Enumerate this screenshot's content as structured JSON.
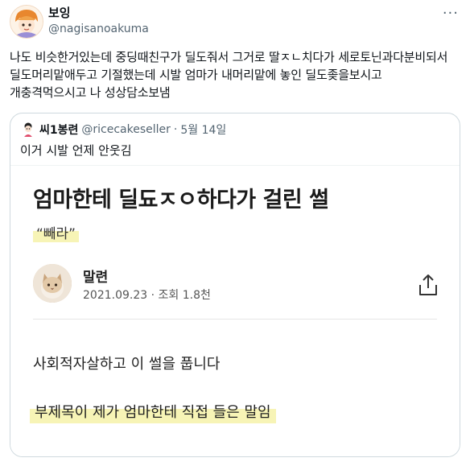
{
  "tweet": {
    "display_name": "보잉",
    "handle": "@nagisanoakuma",
    "text": "나도 비슷한거있는데 중딩때친구가 딜도줘서 그거로 딸ㅈㄴ치다가 세로토닌과다분비되서 딜도머리맡애두고 기절했는데 시발 엄마가 내머리맡에 놓인 딜도좆을보시고 개충격먹으시고 나 성상담소보냄",
    "more_icon": "more-icon"
  },
  "quote": {
    "display_name": "씨1봉련",
    "handle": "@ricecakeseller",
    "date": "5월 14일",
    "text": "이거 시발 언제 안웃김",
    "image": {
      "title": "엄마한테 딜됴ㅈㅇ하다가 걸린 썰",
      "subtitle": "“빼라”",
      "author_name": "말련",
      "author_meta": "2021.09.23 · 조회 1.8천",
      "body_line1": "사회적자살하고 이 썰을 풉니다",
      "body_line2": "부제목이 제가 엄마한테 직접 들은 말임",
      "share_icon": "share-icon"
    }
  },
  "colors": {
    "text": "#0f1419",
    "secondary": "#536471",
    "border": "#cfd9de",
    "highlight": "#f7f4b6"
  }
}
